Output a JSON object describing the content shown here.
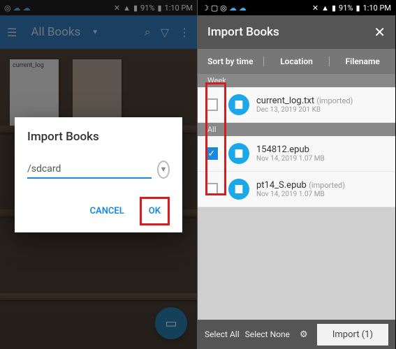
{
  "statusbar": {
    "battery": "91%",
    "time": "1:10 PM"
  },
  "left": {
    "toolbar_title": "All Books",
    "book1_label": "current_log",
    "dialog": {
      "title": "Import Books",
      "path": "/sdcard",
      "cancel": "CANCEL",
      "ok": "OK"
    }
  },
  "right": {
    "header_title": "Import Books",
    "sort": {
      "by_time": "Sort by time",
      "location": "Location",
      "filename": "Filename"
    },
    "sections": {
      "week": "Week",
      "all": "All"
    },
    "files": [
      {
        "name": "current_log.txt",
        "imported": "(imported)",
        "meta": "Dec 13, 2019 201 KB",
        "checked": false
      },
      {
        "name": "154812.epub",
        "imported": "",
        "meta": "Nov 14, 2019 1.07 MB",
        "checked": true
      },
      {
        "name": "pt14_S.epub",
        "imported": "(imported)",
        "meta": "Nov 14, 2019 1.07 MB",
        "checked": false
      }
    ],
    "footer": {
      "select_all": "Select All",
      "select_none": "Select None",
      "import": "Import (1)"
    }
  }
}
